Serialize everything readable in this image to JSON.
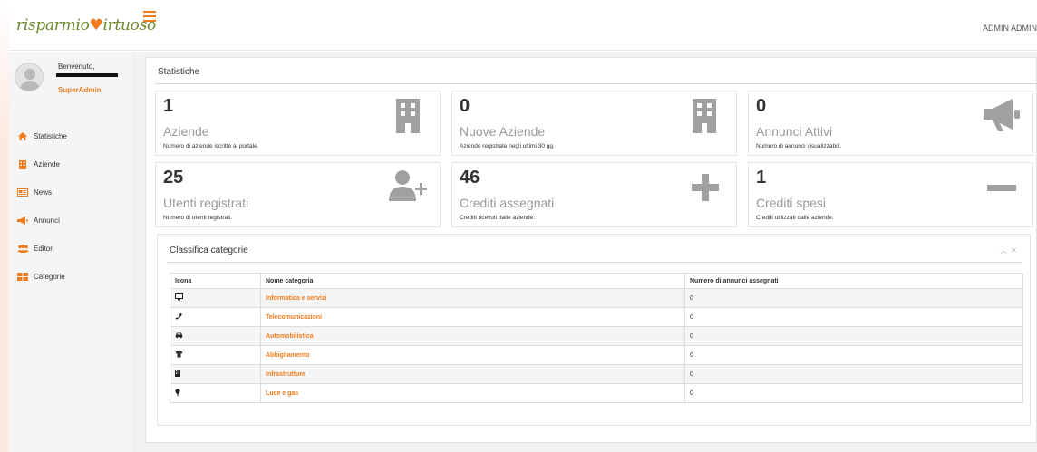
{
  "header": {
    "logo_part1": "risparmio",
    "logo_part2": "irtuoso",
    "user": "ADMIN ADMIN"
  },
  "sidebar": {
    "welcome": "Benvenuto,",
    "role": "SuperAdmin",
    "items": [
      {
        "label": "Statistiche",
        "icon": "home-icon"
      },
      {
        "label": "Aziende",
        "icon": "building-icon"
      },
      {
        "label": "News",
        "icon": "newspaper-icon"
      },
      {
        "label": "Annunci",
        "icon": "megaphone-icon"
      },
      {
        "label": "Editor",
        "icon": "users-icon"
      },
      {
        "label": "Categorie",
        "icon": "grid-icon"
      }
    ]
  },
  "main": {
    "title": "Statistiche",
    "tiles": [
      {
        "value": "1",
        "label": "Aziende",
        "desc": "Numero di aziende iscritte al portale.",
        "icon": "building-icon"
      },
      {
        "value": "0",
        "label": "Nuove Aziende",
        "desc": "Aziende registrate negli ultimi 30 gg.",
        "icon": "building-icon"
      },
      {
        "value": "0",
        "label": "Annunci Attivi",
        "desc": "Numero di annunci visualizzabili.",
        "icon": "megaphone-icon"
      },
      {
        "value": "25",
        "label": "Utenti registrati",
        "desc": "Numero di utenti registrati.",
        "icon": "user-plus-icon"
      },
      {
        "value": "46",
        "label": "Crediti assegnati",
        "desc": "Crediti ricevuti dalle aziende.",
        "icon": "plus-icon"
      },
      {
        "value": "1",
        "label": "Crediti spesi",
        "desc": "Crediti utilizzati dalle aziende.",
        "icon": "minus-icon"
      }
    ]
  },
  "ranking": {
    "title": "Classifica categorie",
    "columns": [
      "Icona",
      "Nome categoria",
      "Numero di annunci assegnati"
    ],
    "rows": [
      {
        "icon": "monitor-icon",
        "name": "Informatica e servizi",
        "count": "0"
      },
      {
        "icon": "phone-icon",
        "name": "Telecomunicazioni",
        "count": "0"
      },
      {
        "icon": "car-icon",
        "name": "Automobilistica",
        "count": "0"
      },
      {
        "icon": "tshirt-icon",
        "name": "Abbigliamento",
        "count": "0"
      },
      {
        "icon": "building-icon",
        "name": "Infrastrutture",
        "count": "0"
      },
      {
        "icon": "bulb-icon",
        "name": "Luce e gas",
        "count": "0"
      }
    ]
  },
  "colors": {
    "accent": "#f07c1f",
    "brand_green": "#6a8a2b",
    "icon_gray": "#a0a0a0"
  }
}
